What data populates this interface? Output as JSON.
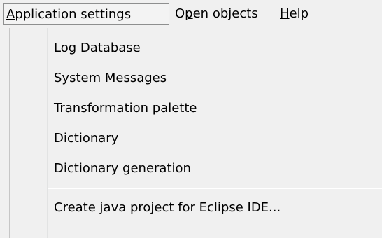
{
  "menubar": {
    "items": [
      {
        "label_mnemonic": "A",
        "label_rest": "pplication settings"
      },
      {
        "label_pre": "O",
        "label_mnemonic": "p",
        "label_rest": "en objects"
      },
      {
        "label_mnemonic": "H",
        "label_rest": "elp"
      }
    ]
  },
  "dropdown": {
    "items": [
      {
        "label": "Log Database"
      },
      {
        "label": "System Messages"
      },
      {
        "label": "Transformation palette"
      },
      {
        "label": "Dictionary"
      },
      {
        "label": "Dictionary generation"
      },
      {
        "label": "Create java project for Eclipse IDE..."
      }
    ]
  }
}
